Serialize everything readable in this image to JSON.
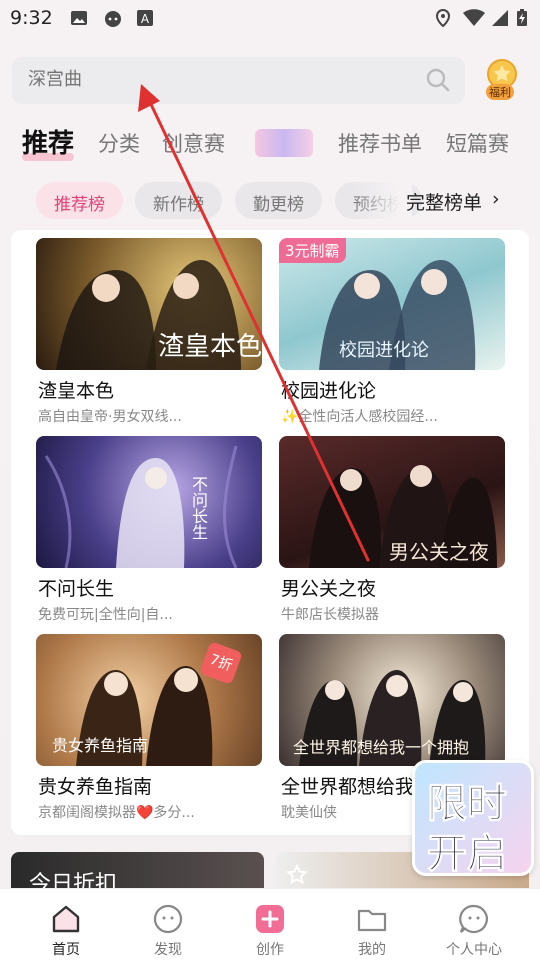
{
  "status_bar": {
    "time": "9:32",
    "icons": [
      "image-icon",
      "android-icon",
      "font-icon",
      "location-icon",
      "wifi-icon",
      "signal-icon",
      "battery-icon"
    ]
  },
  "search": {
    "placeholder": "深宫曲"
  },
  "welfare": {
    "label": "福利"
  },
  "tabs": [
    {
      "label": "推荐",
      "active": true
    },
    {
      "label": "分类"
    },
    {
      "label": "创意赛"
    },
    {
      "label": "推荐书单"
    },
    {
      "label": "短篇赛"
    }
  ],
  "chips": [
    {
      "label": "推荐榜",
      "active": true
    },
    {
      "label": "新作榜"
    },
    {
      "label": "勤更榜"
    },
    {
      "label": "预约榜"
    }
  ],
  "full_list_label": "完整榜单",
  "books": [
    {
      "title": "渣皇本色",
      "desc": "高自由皇帝·男女双线...",
      "cover_text": "渣皇本色"
    },
    {
      "title": "校园进化论",
      "desc": "✨全性向活人感校园经...",
      "badge": "3元制霸",
      "cover_text": "校园进化论"
    },
    {
      "title": "不问长生",
      "desc": "免费可玩|全性向|自...",
      "cover_text": "不问长生"
    },
    {
      "title": "男公关之夜",
      "desc": "牛郎店长模拟器",
      "cover_text": "男公关之夜"
    },
    {
      "title": "贵女养鱼指南",
      "desc": "京都闺阁模拟器❤️多分...",
      "discount": "7折",
      "cover_text": "贵女养鱼指南"
    },
    {
      "title": "全世界都想给我",
      "desc": "耽美仙侠",
      "cover_text": "全世界都想给我一个拥抱"
    }
  ],
  "bottom_strip": {
    "left_label": "今日折扣"
  },
  "promo": {
    "line1": "限时",
    "line2": "开启"
  },
  "nav": [
    {
      "label": "首页",
      "icon": "home-icon",
      "active": true
    },
    {
      "label": "发现",
      "icon": "discover-icon"
    },
    {
      "label": "创作",
      "icon": "create-icon"
    },
    {
      "label": "我的",
      "icon": "folder-icon"
    },
    {
      "label": "个人中心",
      "icon": "profile-icon"
    }
  ],
  "colors": {
    "accent": "#e0457a",
    "chip_active_bg": "#fbe1e8",
    "arrow": "#e03131"
  }
}
